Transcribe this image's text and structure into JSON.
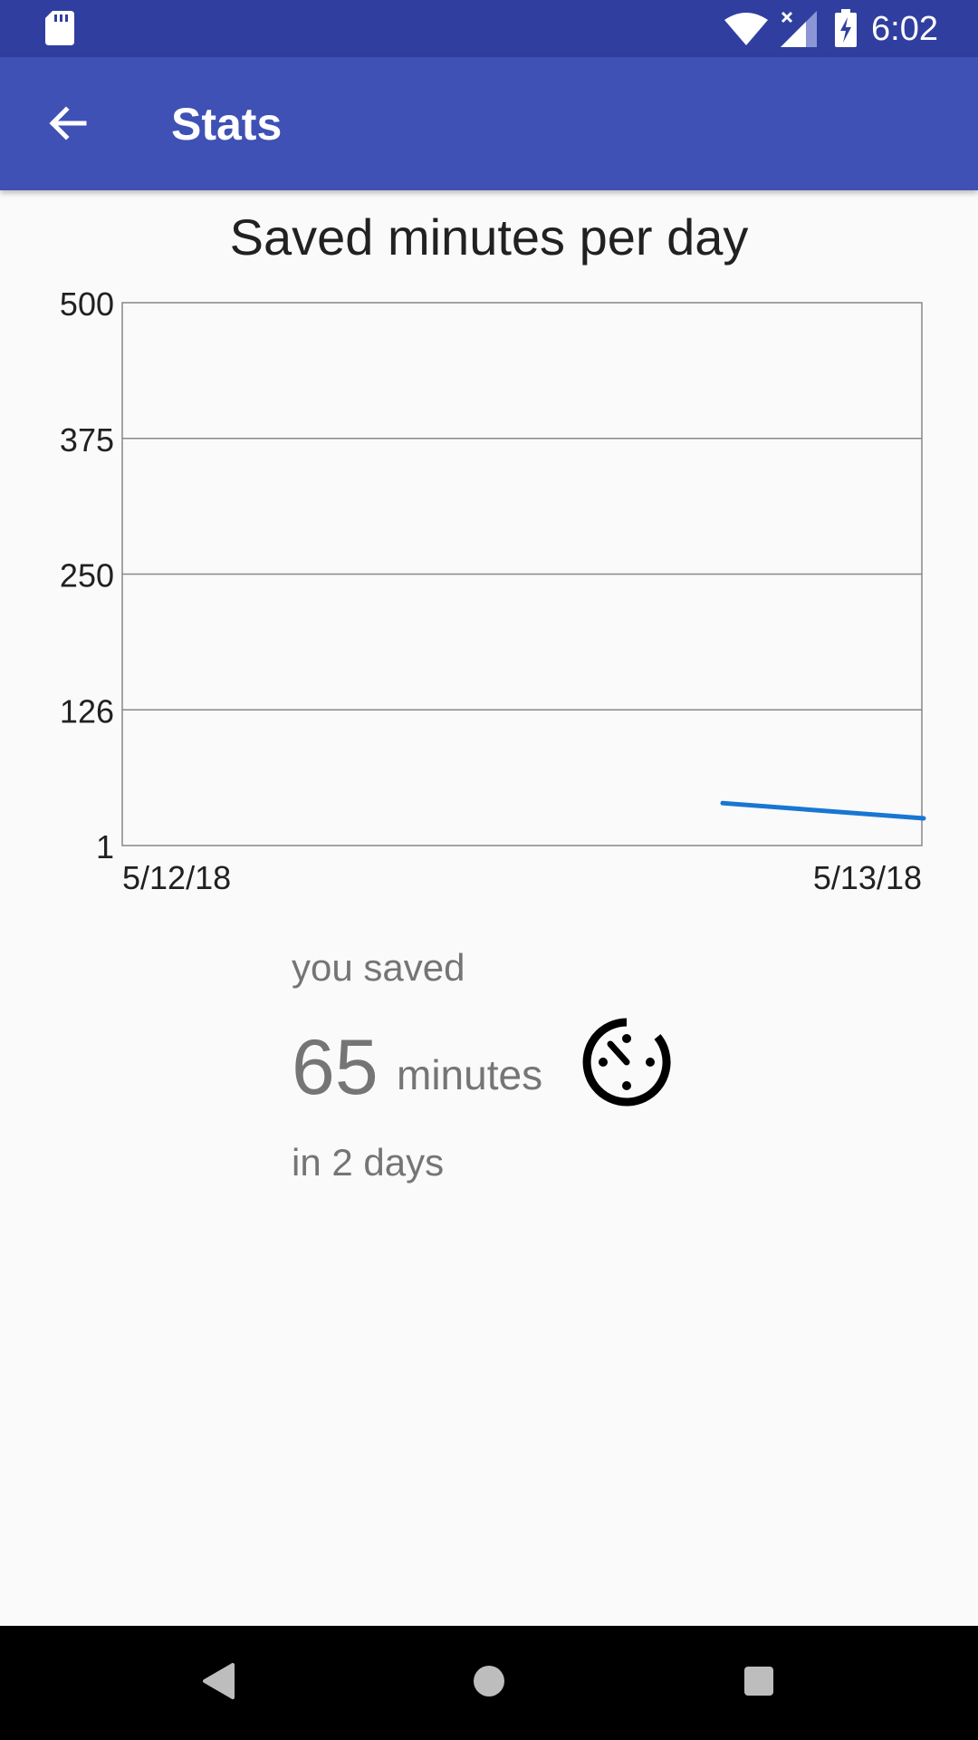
{
  "status_bar": {
    "time": "6:02",
    "icons": [
      "sd-card-icon",
      "wifi-icon",
      "signal-icon",
      "battery-charging-icon"
    ]
  },
  "app_bar": {
    "title": "Stats",
    "back_icon": "arrow-back-icon"
  },
  "chart_data": {
    "type": "line",
    "title": "Saved minutes per day",
    "xlabel": "",
    "ylabel": "",
    "x_tick_labels": [
      "5/12/18",
      "5/13/18"
    ],
    "y_tick_labels": [
      "500",
      "375",
      "250",
      "126",
      "1"
    ],
    "ylim": [
      1,
      500
    ],
    "grid": true,
    "series": [
      {
        "color": "#1976d2",
        "x": [
          "5/12/18",
          "5/13/18"
        ],
        "values": [
          40,
          26
        ]
      }
    ]
  },
  "summary": {
    "saved_label": "you saved",
    "minutes_value": "65",
    "minutes_unit": "minutes",
    "days_label": "in 2 days",
    "icon": "timer-icon"
  },
  "nav_bar": {
    "buttons": [
      "back-nav-icon",
      "home-nav-icon",
      "recents-nav-icon"
    ]
  }
}
